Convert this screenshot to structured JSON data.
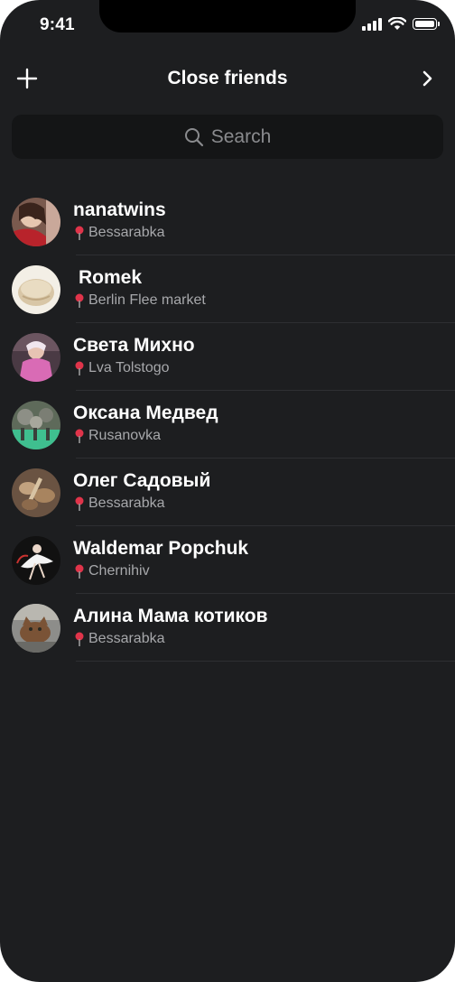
{
  "status": {
    "time": "9:41"
  },
  "header": {
    "title": "Close friends"
  },
  "search": {
    "placeholder": "Search"
  },
  "friends": [
    {
      "name": "nanatwins",
      "location": "Bessarabka"
    },
    {
      "name": "Romek",
      "location": "Berlin Flee market"
    },
    {
      "name": "Света Михно",
      "location": "Lva Tolstogo"
    },
    {
      "name": "Оксана Медвед",
      "location": "Rusanovka"
    },
    {
      "name": "Олег Садовый",
      "location": "Bessarabka"
    },
    {
      "name": "Waldemar Popchuk",
      "location": "Chernihiv"
    },
    {
      "name": "Алина Мама котиков",
      "location": "Bessarabka"
    }
  ],
  "colors": {
    "background": "#1d1e20",
    "search_bg": "#141516",
    "secondary_text": "#a7a8ab",
    "pin": "#e0344a"
  }
}
